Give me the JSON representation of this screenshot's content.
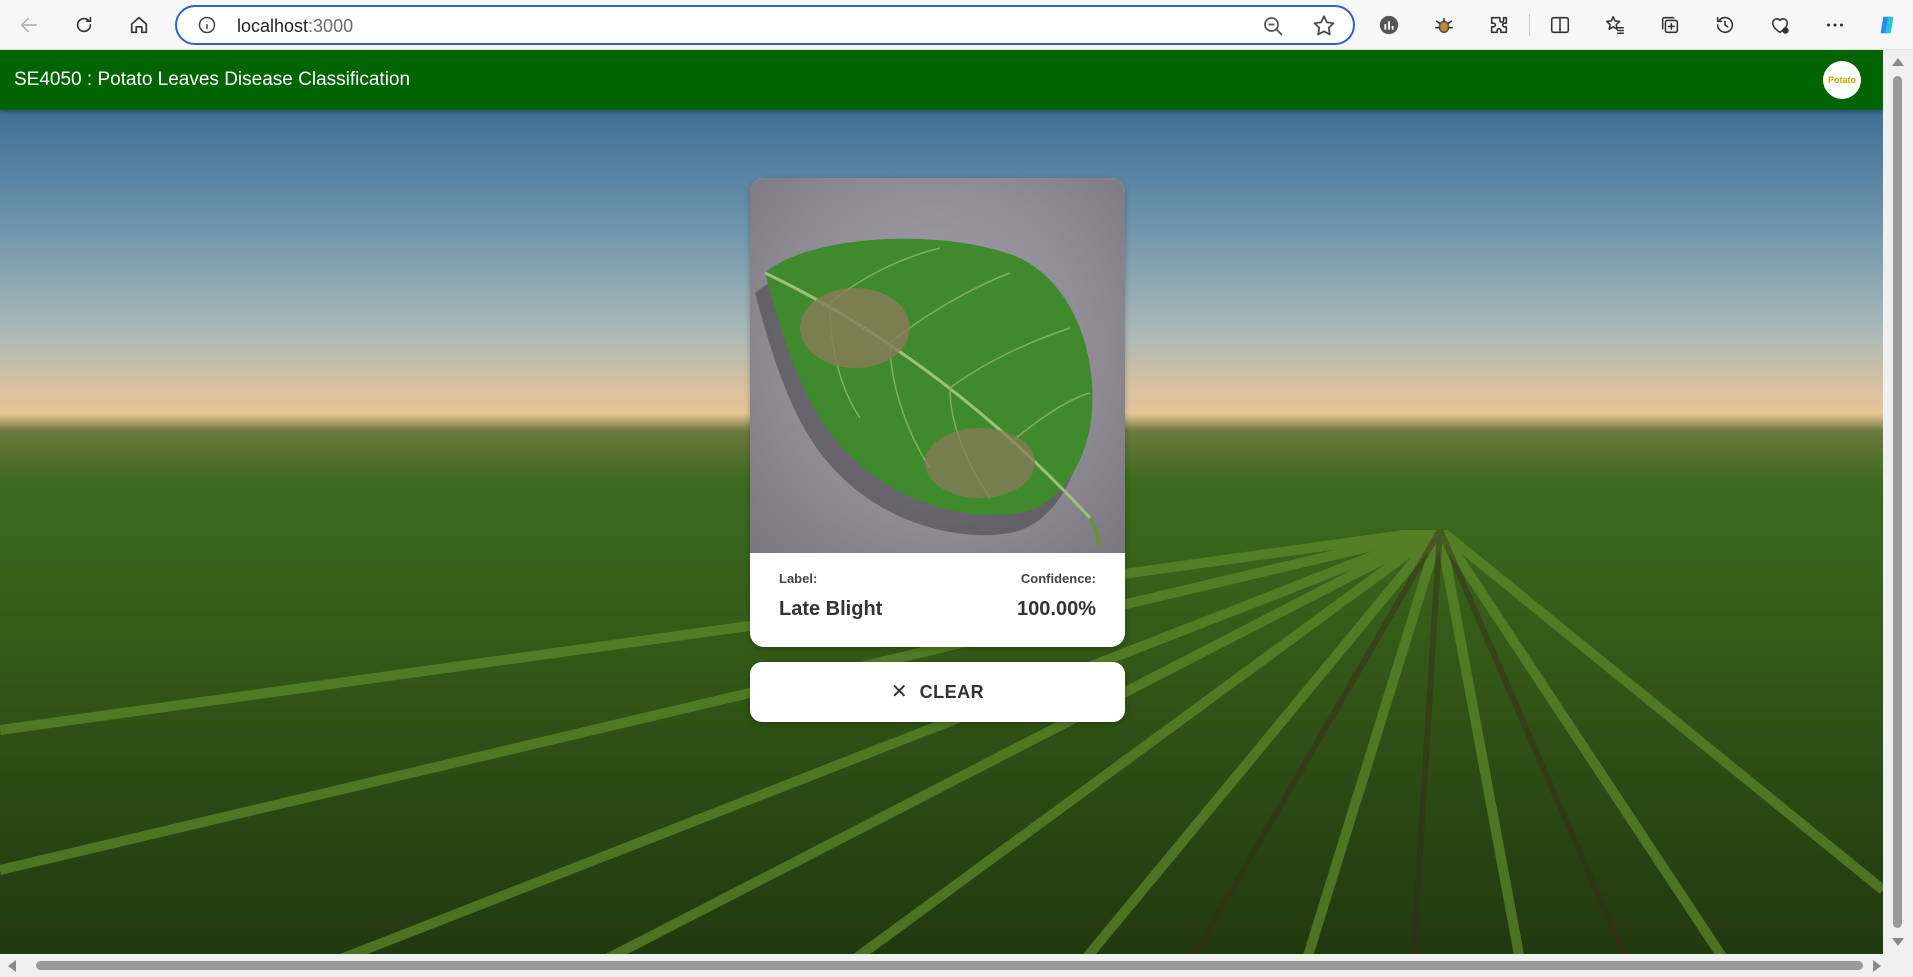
{
  "browser": {
    "url_host": "localhost",
    "url_port": ":3000"
  },
  "app": {
    "title": "SE4050 : Potato Leaves Disease Classification",
    "logo_text": "Potato"
  },
  "result": {
    "label_key": "Label:",
    "label_value": "Late Blight",
    "confidence_key": "Confidence:",
    "confidence_value": "100.00%"
  },
  "actions": {
    "clear_label": "CLEAR"
  },
  "colors": {
    "appbar": "#006400",
    "address_focus": "#2c62d4"
  }
}
